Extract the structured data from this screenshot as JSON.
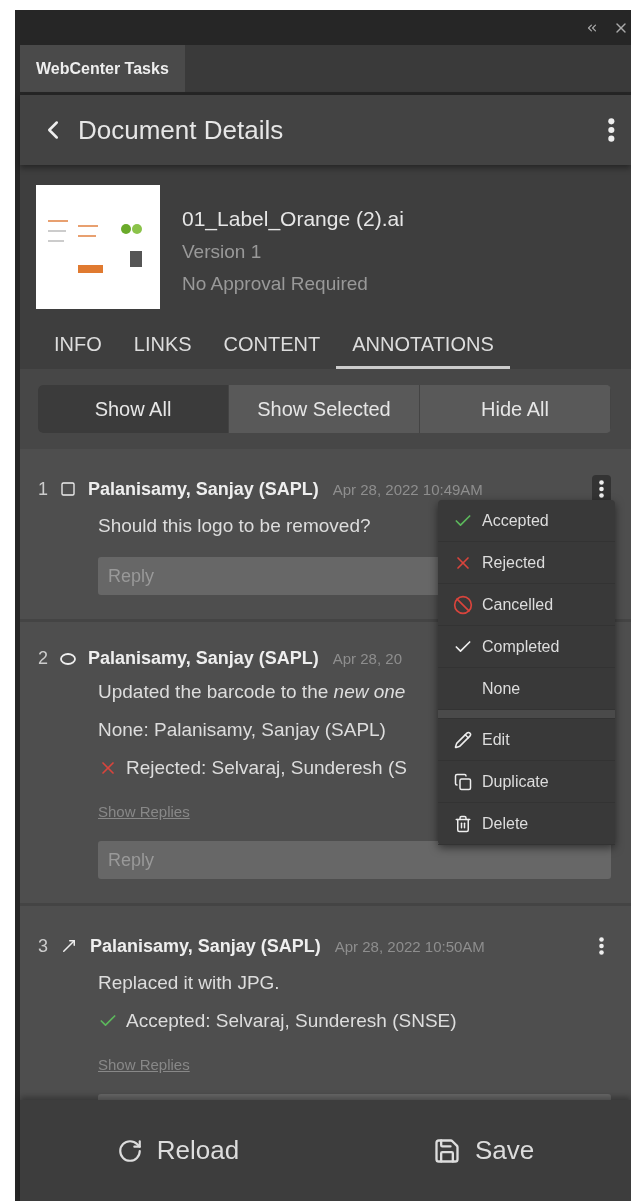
{
  "panel_tab": {
    "label": "WebCenter Tasks"
  },
  "header": {
    "title": "Document Details"
  },
  "document": {
    "name": "01_Label_Orange (2).ai",
    "version": "Version 1",
    "approval": "No Approval Required"
  },
  "tabs": [
    {
      "label": "INFO",
      "selected": false
    },
    {
      "label": "LINKS",
      "selected": false
    },
    {
      "label": "CONTENT",
      "selected": false
    },
    {
      "label": "ANNOTATIONS",
      "selected": true
    }
  ],
  "filter": [
    {
      "label": "Show All",
      "selected": true
    },
    {
      "label": "Show Selected",
      "selected": false
    },
    {
      "label": "Hide All",
      "selected": false
    }
  ],
  "annotations": [
    {
      "number": "1",
      "kind": "rectangle",
      "author": "Palanisamy, Sanjay (SAPL)",
      "date": "Apr 28, 2022 10:49AM",
      "text": "Should this logo to be removed?",
      "menu_open": true,
      "reply_placeholder": "Reply"
    },
    {
      "number": "2",
      "kind": "ellipse",
      "author": "Palanisamy, Sanjay (SAPL)",
      "date": "Apr 28, 20",
      "text": "Updated the barcode to the *new one*",
      "statuses": [
        {
          "kind": "none",
          "text": "None: Palanisamy, Sanjay (SAPL)"
        },
        {
          "kind": "rejected",
          "text": "Rejected: Selvaraj, Sunderesh (S"
        }
      ],
      "show_replies": "Show Replies",
      "reply_placeholder": "Reply"
    },
    {
      "number": "3",
      "kind": "arrow",
      "author": "Palanisamy, Sanjay (SAPL)",
      "date": "Apr 28, 2022 10:50AM",
      "text": "Replaced it with JPG.",
      "menu_open": false,
      "statuses": [
        {
          "kind": "accepted",
          "text": "Accepted: Selvaraj, Sunderesh (SNSE)"
        }
      ],
      "show_replies": "Show Replies"
    }
  ],
  "context_menu": {
    "status_items": [
      {
        "kind": "accepted",
        "label": "Accepted"
      },
      {
        "kind": "rejected",
        "label": "Rejected"
      },
      {
        "kind": "cancelled",
        "label": "Cancelled"
      },
      {
        "kind": "completed",
        "label": "Completed"
      },
      {
        "kind": "none",
        "label": "None"
      }
    ],
    "action_items": [
      {
        "kind": "edit",
        "label": "Edit"
      },
      {
        "kind": "duplicate",
        "label": "Duplicate"
      },
      {
        "kind": "delete",
        "label": "Delete"
      }
    ]
  },
  "footer": {
    "reload": "Reload",
    "save": "Save"
  }
}
